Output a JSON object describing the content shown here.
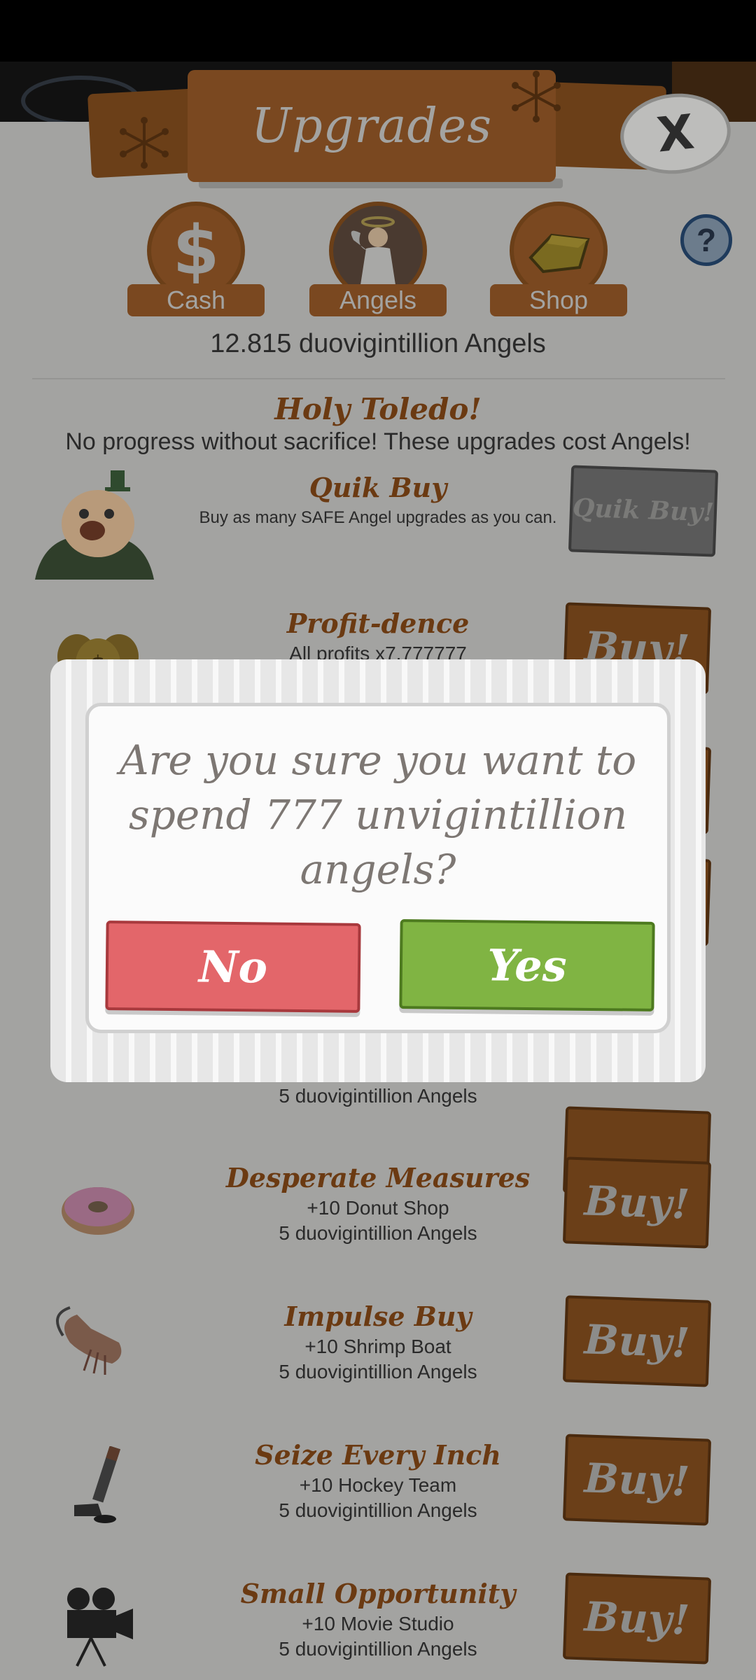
{
  "header": {
    "title": "Upgrades",
    "close_label": "X",
    "help_label": "?"
  },
  "tabs": [
    {
      "label": "Cash",
      "icon": "dollar-icon"
    },
    {
      "label": "Angels",
      "icon": "angel-icon"
    },
    {
      "label": "Shop",
      "icon": "gold-bar-icon"
    }
  ],
  "angels_count": "12.815 duovigintillion Angels",
  "section": {
    "title": "Holy Toledo!",
    "subtitle": "No progress without sacrifice! These upgrades cost Angels!"
  },
  "quik_buy": {
    "name": "Quik Buy",
    "description": "Buy as many SAFE Angel upgrades as you can.",
    "button_label": "Quik Buy!",
    "icon": "mascot-icon"
  },
  "upgrades": [
    {
      "name": "Profit-dence",
      "line1": "All profits x7.777777",
      "line2": "",
      "button_label": "Buy!",
      "icon": "money-bags-icon"
    },
    {
      "name": "",
      "line1": "",
      "line2": "5 duovigintillion Angels",
      "button_label": "",
      "icon": ""
    },
    {
      "name": "Desperate Measures",
      "line1": "+10 Donut Shop",
      "line2": "5 duovigintillion Angels",
      "button_label": "Buy!",
      "icon": "donut-icon"
    },
    {
      "name": "Impulse Buy",
      "line1": "+10 Shrimp Boat",
      "line2": "5 duovigintillion Angels",
      "button_label": "Buy!",
      "icon": "shrimp-icon"
    },
    {
      "name": "Seize Every Inch",
      "line1": "+10 Hockey Team",
      "line2": "5 duovigintillion Angels",
      "button_label": "Buy!",
      "icon": "hockey-stick-icon"
    },
    {
      "name": "Small Opportunity",
      "line1": "+10 Movie Studio",
      "line2": "5 duovigintillion Angels",
      "button_label": "Buy!",
      "icon": "movie-camera-icon"
    }
  ],
  "dialog": {
    "message": "Are you sure you want to spend 777 unvigintillion angels?",
    "no_label": "No",
    "yes_label": "Yes",
    "no_color": "#e3666a",
    "yes_color": "#80b443"
  }
}
